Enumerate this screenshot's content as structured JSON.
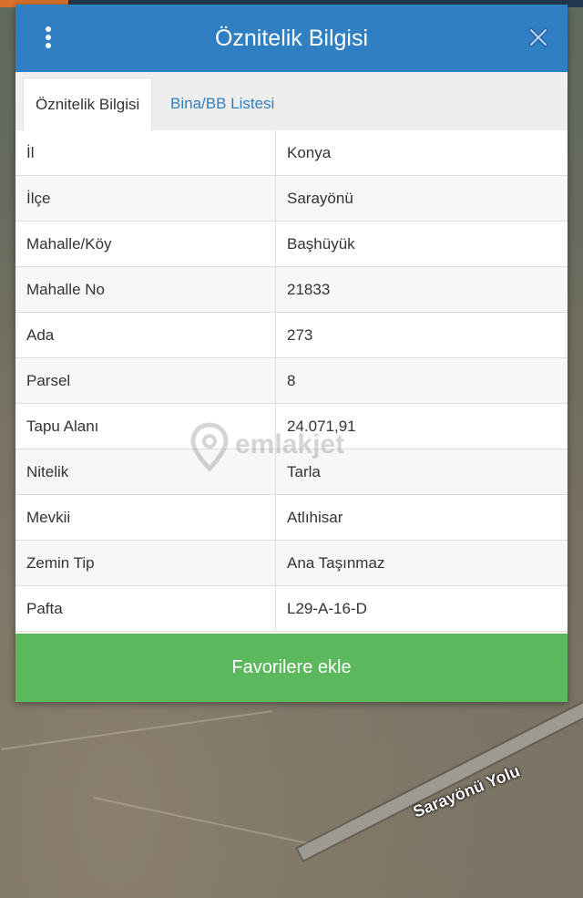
{
  "dialog": {
    "title": "Öznitelik Bilgisi",
    "menu_icon": "kebab-menu-icon",
    "close_icon": "close-icon"
  },
  "tabs": [
    {
      "label": "Öznitelik Bilgisi",
      "active": true
    },
    {
      "label": "Bina/BB Listesi",
      "active": false
    }
  ],
  "attributes": [
    {
      "key": "İl",
      "value": "Konya"
    },
    {
      "key": "İlçe",
      "value": "Sarayönü"
    },
    {
      "key": "Mahalle/Köy",
      "value": "Başhüyük"
    },
    {
      "key": "Mahalle No",
      "value": "21833"
    },
    {
      "key": "Ada",
      "value": "273"
    },
    {
      "key": "Parsel",
      "value": "8"
    },
    {
      "key": "Tapu Alanı",
      "value": "24.071,91"
    },
    {
      "key": "Nitelik",
      "value": "Tarla"
    },
    {
      "key": "Mevkii",
      "value": "Atlıhisar"
    },
    {
      "key": "Zemin Tip",
      "value": "Ana Taşınmaz"
    },
    {
      "key": "Pafta",
      "value": "L29-A-16-D"
    }
  ],
  "favorite_button": "Favorilere ekle",
  "watermark": "emlakjet",
  "map": {
    "road_label": "Sarayönü Yolu"
  },
  "colors": {
    "header": "#2f7fc2",
    "button": "#5cb85c",
    "link": "#2f7fc2"
  }
}
